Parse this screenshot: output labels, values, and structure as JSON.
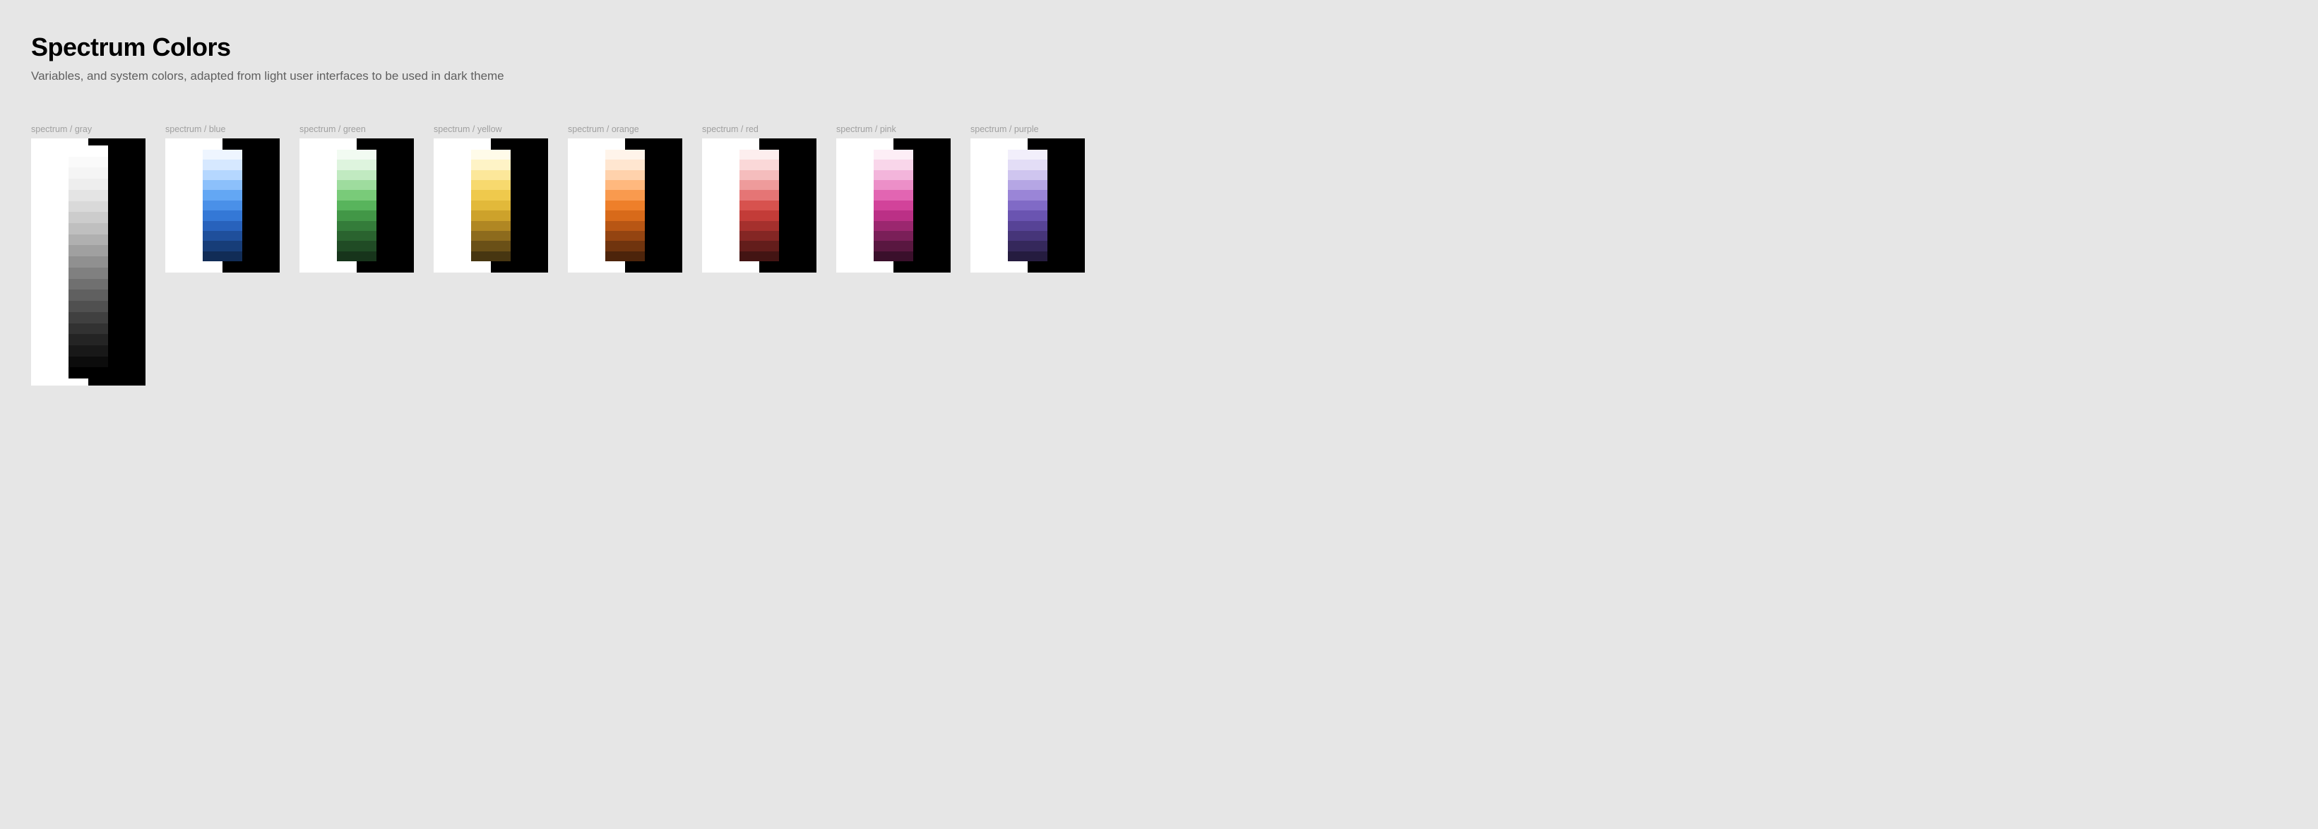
{
  "header": {
    "title": "Spectrum Colors",
    "subtitle": "Variables, and system colors, adapted from light user interfaces to be used in dark theme"
  },
  "card_backgrounds": {
    "light": "#ffffff",
    "dark": "#000000"
  },
  "palettes": [
    {
      "id": "gray",
      "label": "spectrum / gray",
      "tall": true,
      "colors": [
        "#ffffff",
        "#fafafa",
        "#f5f5f5",
        "#eeeeee",
        "#e4e4e4",
        "#d9d9d9",
        "#cccccc",
        "#bfbfbf",
        "#b0b0b0",
        "#a0a0a0",
        "#909090",
        "#808080",
        "#707070",
        "#606060",
        "#505050",
        "#404040",
        "#323232",
        "#242424",
        "#181818",
        "#0c0c0c",
        "#000000"
      ]
    },
    {
      "id": "blue",
      "label": "spectrum / blue",
      "tall": false,
      "colors": [
        "#eef5ff",
        "#d6e8ff",
        "#b5d7ff",
        "#8cc0fb",
        "#63a7f4",
        "#4a90e8",
        "#3478d6",
        "#2862bc",
        "#1f4f9b",
        "#173d78",
        "#112c56"
      ]
    },
    {
      "id": "green",
      "label": "spectrum / green",
      "tall": false,
      "colors": [
        "#f2fbf2",
        "#def4de",
        "#c1eac1",
        "#9edc9e",
        "#79cb79",
        "#58b45c",
        "#429747",
        "#347c3a",
        "#2a632f",
        "#204b25",
        "#17341b"
      ]
    },
    {
      "id": "yellow",
      "label": "spectrum / yellow",
      "tall": false,
      "colors": [
        "#fffbe9",
        "#fef3c6",
        "#fce79a",
        "#f7d96e",
        "#efc94c",
        "#e2b93a",
        "#cda22b",
        "#b08723",
        "#8d6b1d",
        "#6a5017",
        "#473611"
      ]
    },
    {
      "id": "orange",
      "label": "spectrum / orange",
      "tall": false,
      "colors": [
        "#fff4ea",
        "#ffe6d0",
        "#ffd2ac",
        "#ffb87e",
        "#f99a4e",
        "#ee7f2a",
        "#d86a1a",
        "#b85614",
        "#944411",
        "#70340e",
        "#4d240b"
      ]
    },
    {
      "id": "red",
      "label": "spectrum / red",
      "tall": false,
      "colors": [
        "#fdeeee",
        "#fad8d8",
        "#f5bdbd",
        "#ee9b9b",
        "#e57575",
        "#d7524e",
        "#c33c38",
        "#a5302d",
        "#842624",
        "#631d1b",
        "#431413"
      ]
    },
    {
      "id": "pink",
      "label": "spectrum / pink",
      "tall": false,
      "colors": [
        "#fdeef6",
        "#f9d6ea",
        "#f3b5db",
        "#ec8fc8",
        "#e265b2",
        "#d2439a",
        "#bb3086",
        "#9b276f",
        "#7a1f58",
        "#591740",
        "#3a0f2b"
      ]
    },
    {
      "id": "purple",
      "label": "spectrum / purple",
      "tall": false,
      "colors": [
        "#f2effb",
        "#e3ddf6",
        "#cfc5ef",
        "#b5a6e4",
        "#9a85d7",
        "#806ac6",
        "#6a54b1",
        "#574396",
        "#463579",
        "#35285b",
        "#251c3f"
      ]
    }
  ]
}
